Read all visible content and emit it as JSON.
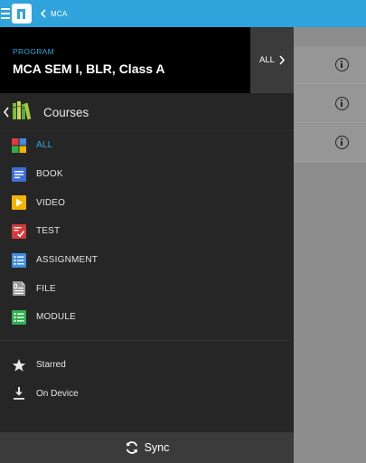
{
  "header": {
    "breadcrumb": "MCA",
    "icons": [
      "menu-icon",
      "app-logo",
      "back-chevron-icon"
    ]
  },
  "drawer": {
    "program": {
      "label": "PROGRAM",
      "name": "MCA SEM I, BLR, Class A"
    },
    "all_button": "ALL",
    "courses_title": "Courses",
    "filters": [
      {
        "label": "ALL",
        "icon": "all-grid-icon",
        "active": true,
        "color": "#33a7e0"
      },
      {
        "label": "BOOK",
        "icon": "book-icon",
        "active": false,
        "color": "#3e6fd8"
      },
      {
        "label": "VIDEO",
        "icon": "video-icon",
        "active": false,
        "color": "#f2b400"
      },
      {
        "label": "TEST",
        "icon": "test-icon",
        "active": false,
        "color": "#d63a3a"
      },
      {
        "label": "ASSIGNMENT",
        "icon": "assignment-icon",
        "active": false,
        "color": "#3f8ee0"
      },
      {
        "label": "FILE",
        "icon": "file-icon",
        "active": false,
        "color": "#9a9a9a"
      },
      {
        "label": "MODULE",
        "icon": "module-icon",
        "active": false,
        "color": "#2fae4e"
      }
    ],
    "secondary": [
      {
        "label": "Starred",
        "icon": "star-icon"
      },
      {
        "label": "On Device",
        "icon": "download-icon"
      }
    ],
    "sync_label": "Sync"
  },
  "background_rows": [
    {
      "icon": "info-icon"
    },
    {
      "icon": "info-icon"
    },
    {
      "icon": "info-icon"
    }
  ],
  "colors": {
    "appbar": "#2fa3dc",
    "accent": "#33a7e0",
    "drawer_bg": "#262626",
    "program_bg": "#000000"
  }
}
